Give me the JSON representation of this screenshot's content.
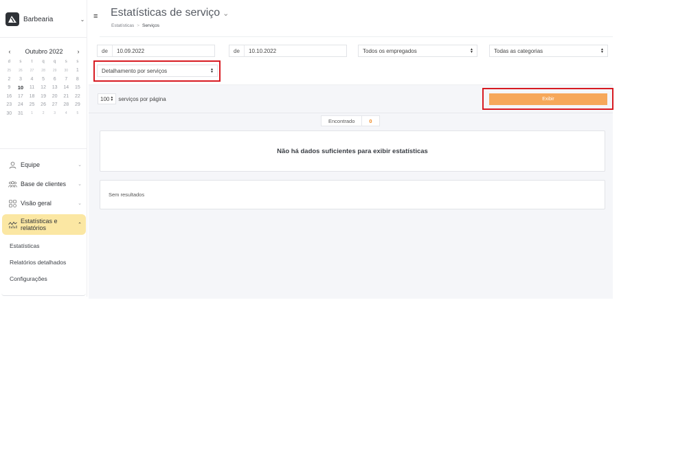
{
  "sidebar": {
    "brand": {
      "name": "Barbearia",
      "chevron_icon": "chevron-down-icon"
    },
    "calendar": {
      "month_label": "Outubro 2022",
      "prev_icon": "chevron-left-icon",
      "next_icon": "chevron-right-icon",
      "weekdays": [
        "d",
        "s",
        "t",
        "q",
        "q",
        "s",
        "s"
      ],
      "days": [
        [
          "25",
          "26",
          "27",
          "28",
          "29",
          "30",
          "1"
        ],
        [
          "2",
          "3",
          "4",
          "5",
          "6",
          "7",
          "8"
        ],
        [
          "9",
          "10",
          "11",
          "12",
          "13",
          "14",
          "15"
        ],
        [
          "16",
          "17",
          "18",
          "19",
          "20",
          "21",
          "22"
        ],
        [
          "23",
          "24",
          "25",
          "26",
          "27",
          "28",
          "29"
        ],
        [
          "30",
          "31",
          "1",
          "2",
          "3",
          "4",
          "5"
        ]
      ],
      "selected_day": "10"
    },
    "menu": [
      {
        "label": "Equipe",
        "icon": "person-icon"
      },
      {
        "label": "Base de clientes",
        "icon": "people-icon"
      },
      {
        "label": "Visão geral",
        "icon": "grid-icon"
      },
      {
        "label": "Estatísticas e relatórios",
        "icon": "activity-chart-icon"
      }
    ],
    "submenu": [
      "Estatísticas",
      "Relatórios detalhados",
      "Configurações"
    ]
  },
  "header": {
    "title": "Estatísticas de serviço",
    "breadcrumb": [
      "Estatísticas",
      "Serviços"
    ],
    "menu_icon": "hamburger-icon"
  },
  "filters": {
    "from_prefix": "de",
    "from_date": "10.09.2022",
    "to_prefix": "de",
    "to_date": "10.10.2022",
    "employees": "Todos os empregados",
    "categories": "Todas as categorias",
    "breakdown": "Detalhamento por serviços"
  },
  "toolbar": {
    "per_page_value": "100",
    "per_page_label": "serviços por página",
    "show_button": "Exibir"
  },
  "results": {
    "found_label": "Encontrado",
    "found_count": "0",
    "insufficient_message": "Não há dados suficientes para exibir estatísticas",
    "empty_message": "Sem resultados"
  },
  "colors": {
    "accent": "#f6a85a",
    "active_menu": "#fbe7a3",
    "highlight": "#d71920"
  }
}
